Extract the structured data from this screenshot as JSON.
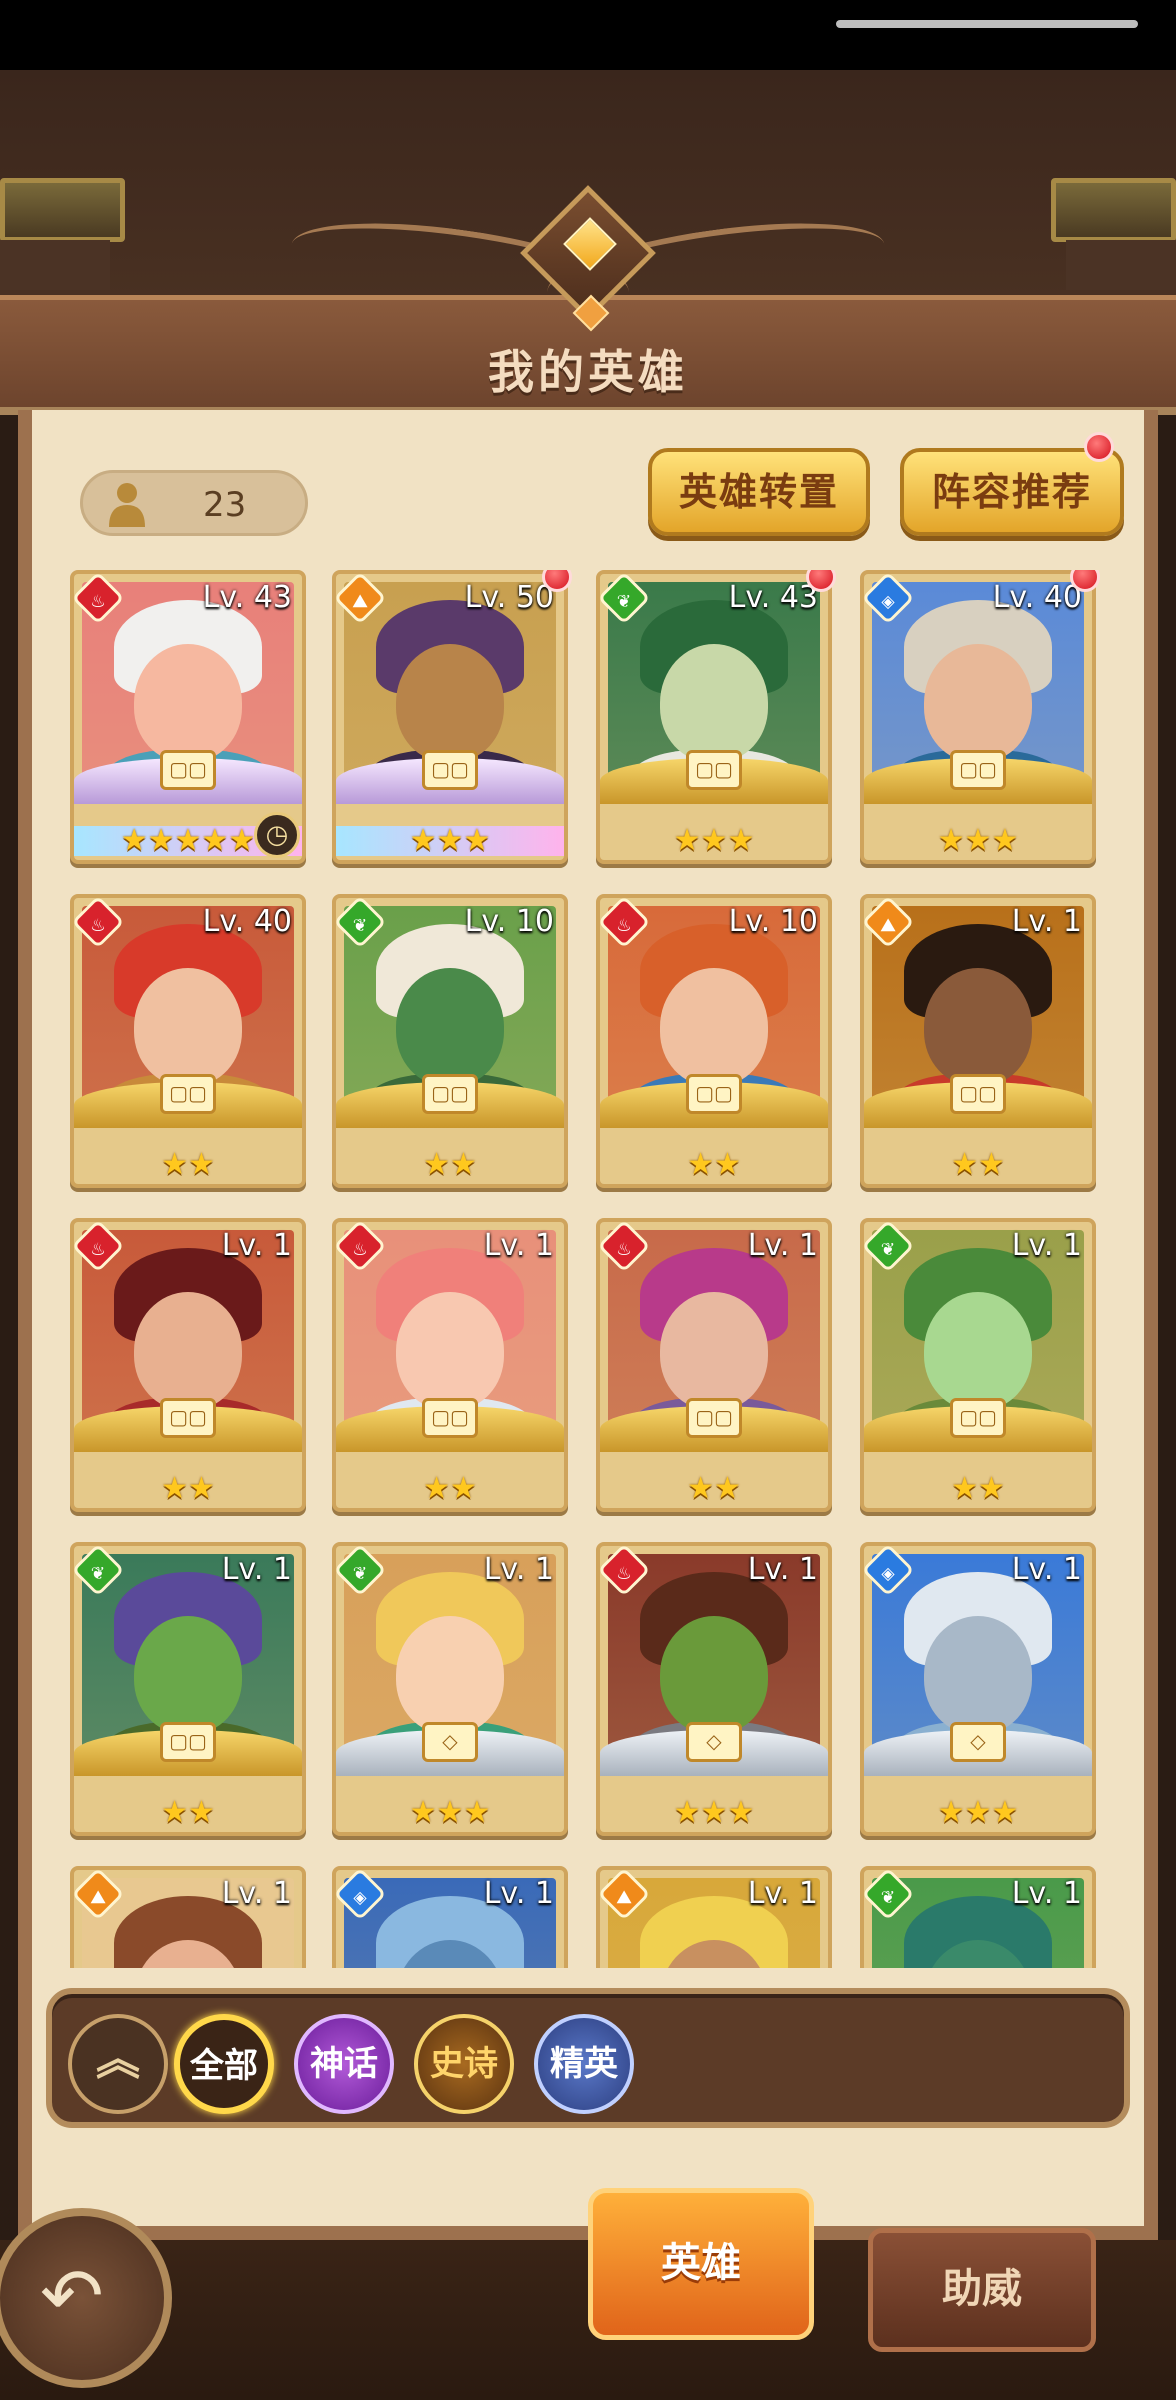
{
  "header": {
    "title": "我的英雄"
  },
  "hero_count": "23",
  "buttons": {
    "transfer": "英雄转置",
    "recommend": "阵容推荐"
  },
  "filters": [
    "全部",
    "神话",
    "史诗",
    "精英"
  ],
  "tabs": {
    "heroes": "英雄",
    "support": "助威"
  },
  "heroes": [
    {
      "level": "Lv. 43",
      "element": "fire",
      "stars": "★★★★★",
      "rank": "mythic",
      "timer": true,
      "new": false
    },
    {
      "level": "Lv. 50",
      "element": "earth",
      "stars": "★★★",
      "rank": "mythic",
      "timer": false,
      "new": true
    },
    {
      "level": "Lv. 43",
      "element": "nature",
      "stars": "★★★",
      "rank": "epic",
      "timer": false,
      "new": true
    },
    {
      "level": "Lv. 40",
      "element": "water",
      "stars": "★★★",
      "rank": "epic",
      "timer": false,
      "new": true
    },
    {
      "level": "Lv. 40",
      "element": "fire",
      "stars": "★★",
      "rank": "epic",
      "timer": false,
      "new": false
    },
    {
      "level": "Lv. 10",
      "element": "nature",
      "stars": "★★",
      "rank": "epic",
      "timer": false,
      "new": false
    },
    {
      "level": "Lv. 10",
      "element": "fire",
      "stars": "★★",
      "rank": "epic",
      "timer": false,
      "new": false
    },
    {
      "level": "Lv. 1",
      "element": "earth",
      "stars": "★★",
      "rank": "epic",
      "timer": false,
      "new": false
    },
    {
      "level": "Lv. 1",
      "element": "fire",
      "stars": "★★",
      "rank": "epic",
      "timer": false,
      "new": false
    },
    {
      "level": "Lv. 1",
      "element": "fire",
      "stars": "★★",
      "rank": "epic",
      "timer": false,
      "new": false
    },
    {
      "level": "Lv. 1",
      "element": "fire",
      "stars": "★★",
      "rank": "epic",
      "timer": false,
      "new": false
    },
    {
      "level": "Lv. 1",
      "element": "nature",
      "stars": "★★",
      "rank": "epic",
      "timer": false,
      "new": false
    },
    {
      "level": "Lv. 1",
      "element": "nature",
      "stars": "★★",
      "rank": "epic",
      "timer": false,
      "new": false
    },
    {
      "level": "Lv. 1",
      "element": "nature",
      "stars": "★★★",
      "rank": "elite",
      "timer": false,
      "new": false
    },
    {
      "level": "Lv. 1",
      "element": "fire",
      "stars": "★★★",
      "rank": "elite",
      "timer": false,
      "new": false
    },
    {
      "level": "Lv. 1",
      "element": "water",
      "stars": "★★★",
      "rank": "elite",
      "timer": false,
      "new": false
    },
    {
      "level": "Lv. 1",
      "element": "earth",
      "stars": "",
      "rank": "epic",
      "timer": false,
      "new": false
    },
    {
      "level": "Lv. 1",
      "element": "water",
      "stars": "",
      "rank": "epic",
      "timer": false,
      "new": false
    },
    {
      "level": "Lv. 1",
      "element": "earth",
      "stars": "",
      "rank": "epic",
      "timer": false,
      "new": false
    },
    {
      "level": "Lv. 1",
      "element": "nature",
      "stars": "",
      "rank": "epic",
      "timer": false,
      "new": false
    }
  ],
  "element_colors": {
    "fire": "#d8222c",
    "earth": "#f08a1a",
    "nature": "#35a82a",
    "water": "#2a7be0"
  },
  "portrait_palettes": [
    {
      "bg": "#e8807a",
      "hair": "#f1f0ee",
      "skin": "#f6b8a0",
      "body": "#4aa0b8"
    },
    {
      "bg": "#c8a050",
      "hair": "#5a3a6a",
      "skin": "#b8844a",
      "body": "#3a2a4a"
    },
    {
      "bg": "#3a7a4a",
      "hair": "#2a6a3a",
      "skin": "#c8d8a8",
      "body": "#e8e8e0"
    },
    {
      "bg": "#5a8ad8",
      "hair": "#d8d0c0",
      "skin": "#e8b898",
      "body": "#2a6a9a"
    },
    {
      "bg": "#c85a3a",
      "hair": "#d83a2a",
      "skin": "#f0c0a0",
      "body": "#c88a3a"
    },
    {
      "bg": "#6aa04a",
      "hair": "#f0e8d8",
      "skin": "#4a8a4a",
      "body": "#3a6a3a"
    },
    {
      "bg": "#d86a3a",
      "hair": "#d8602a",
      "skin": "#f0c0a0",
      "body": "#3a7ab8"
    },
    {
      "bg": "#b8701a",
      "hair": "#2a1a10",
      "skin": "#8a5a3a",
      "body": "#c83a2a"
    },
    {
      "bg": "#c85a3a",
      "hair": "#6a1a1a",
      "skin": "#e8b090",
      "body": "#a82a2a"
    },
    {
      "bg": "#e8907a",
      "hair": "#f0807a",
      "skin": "#f8c8b0",
      "body": "#e0e8f0"
    },
    {
      "bg": "#c86a4a",
      "hair": "#b83a8a",
      "skin": "#e8b8a0",
      "body": "#7a5a9a"
    },
    {
      "bg": "#9aa04a",
      "hair": "#4a8a3a",
      "skin": "#a8d890",
      "body": "#6a8a3a"
    },
    {
      "bg": "#3a7a5a",
      "hair": "#5a4a9a",
      "skin": "#6aa84a",
      "body": "#4a6a2a"
    },
    {
      "bg": "#d8a05a",
      "hair": "#f0c85a",
      "skin": "#f8d0b0",
      "body": "#3aa07a"
    },
    {
      "bg": "#8a3a2a",
      "hair": "#5a2a1a",
      "skin": "#6a9a3a",
      "body": "#7a7a80"
    },
    {
      "bg": "#3a7ad8",
      "hair": "#e0e8f0",
      "skin": "#a8b8c8",
      "body": "#8ab0d0"
    },
    {
      "bg": "#e8c890",
      "hair": "#8a4a2a",
      "skin": "#e8b090",
      "body": "#c8c8c8"
    },
    {
      "bg": "#3a6ab8",
      "hair": "#8ab8e0",
      "skin": "#5a8ab8",
      "body": "#3a5a8a"
    },
    {
      "bg": "#d8a83a",
      "hair": "#f0d050",
      "skin": "#c89060",
      "body": "#8a6a2a"
    },
    {
      "bg": "#4a9a4a",
      "hair": "#2a7a6a",
      "skin": "#3a8a6a",
      "body": "#2a5a3a"
    }
  ]
}
